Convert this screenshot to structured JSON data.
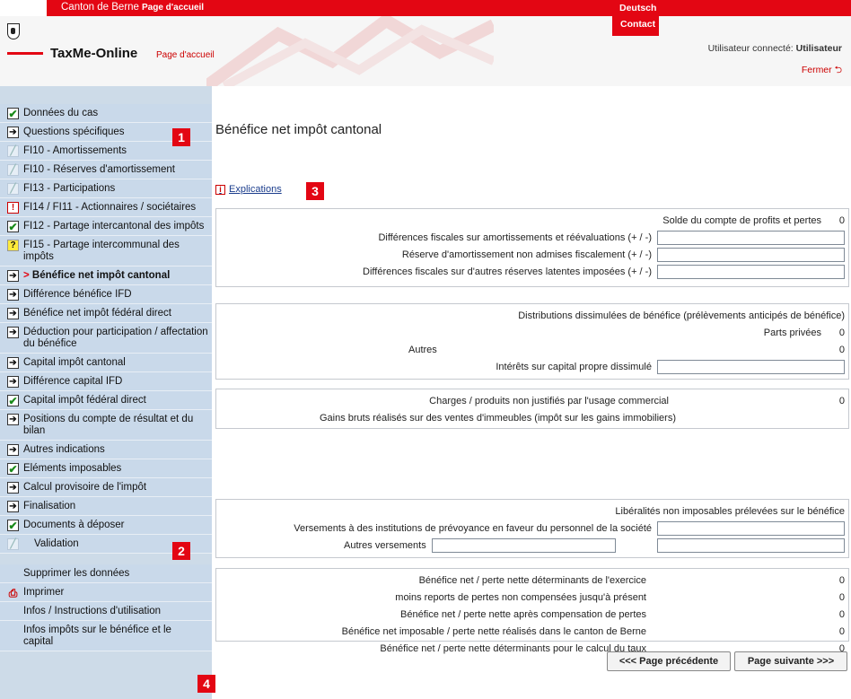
{
  "topbar": {
    "canton": "Canton de Berne",
    "home": "Page d'accueil",
    "language": "Deutsch"
  },
  "header": {
    "contact": "Contact",
    "app_title": "TaxMe-Online",
    "home": "Page d'accueil",
    "user_prefix": "Utilisateur connecté: ",
    "user_name": "Utilisateur",
    "logout": "Fermer"
  },
  "sidebar": {
    "items": [
      {
        "status": "ok",
        "label": "Données du cas"
      },
      {
        "status": "arrow",
        "label": "Questions spécifiques"
      },
      {
        "status": "pencil",
        "label": "FI10 - Amortissements"
      },
      {
        "status": "pencil",
        "label": "FI10 - Réserves d'amortissement"
      },
      {
        "status": "pencil",
        "label": "FI13 - Participations"
      },
      {
        "status": "warn",
        "label": "FI14 / FI11 - Actionnaires / sociétaires"
      },
      {
        "status": "ok",
        "label": "FI12 - Partage intercantonal des impôts"
      },
      {
        "status": "q",
        "label": "FI15 - Partage intercommunal des impôts"
      },
      {
        "status": "arrow",
        "label": "Bénéfice net impôt cantonal",
        "active_marker": ">"
      },
      {
        "status": "arrow",
        "label": "Différence bénéfice IFD"
      },
      {
        "status": "arrow",
        "label": "Bénéfice net impôt fédéral direct"
      },
      {
        "status": "arrow",
        "label": "Déduction pour participation / affectation du bénéfice"
      },
      {
        "status": "arrow",
        "label": "Capital impôt cantonal"
      },
      {
        "status": "arrow",
        "label": "Différence capital IFD"
      },
      {
        "status": "ok",
        "label": "Capital impôt fédéral direct"
      },
      {
        "status": "arrow",
        "label": "Positions du compte de résultat et du bilan"
      },
      {
        "status": "arrow",
        "label": "Autres indications"
      },
      {
        "status": "ok",
        "label": "Eléments imposables"
      },
      {
        "status": "arrow",
        "label": "Calcul provisoire de l'impôt"
      },
      {
        "status": "arrow",
        "label": "Finalisation"
      },
      {
        "status": "ok",
        "label": "Documents à déposer"
      },
      {
        "status": "pencil",
        "label": "Validation"
      }
    ],
    "tools": [
      {
        "label": "Supprimer les données"
      },
      {
        "label": "Imprimer"
      },
      {
        "label": "Infos / Instructions d'utilisation"
      },
      {
        "label": "Infos impôts sur le bénéfice et le capital"
      }
    ]
  },
  "badges": [
    "1",
    "2",
    "3",
    "4"
  ],
  "main": {
    "title": "Bénéfice net impôt cantonal",
    "explanations_link": "Explications",
    "section1": {
      "solde_label": "Solde du compte de profits et pertes",
      "solde_value": "0",
      "diff_amort_label": "Différences fiscales sur amortissements et réévaluations (+ / -)",
      "reserve_label": "Réserve d'amortissement non admises fiscalement (+ / -)",
      "diff_autres_label": "Différences fiscales sur d'autres réserves latentes imposées (+ / -)"
    },
    "section2": {
      "distributions_label": "Distributions dissimulées de bénéfice (prélèvements anticipés de bénéfice)",
      "parts_label": "Parts privées",
      "parts_value": "0",
      "autres_label": "Autres",
      "autres_value": "0",
      "interets_label": "Intérêts sur capital propre dissimulé"
    },
    "section3": {
      "charges_label": "Charges / produits non justifiés par l'usage commercial",
      "charges_value": "0",
      "gains_label": "Gains bruts réalisés sur des ventes d'immeubles (impôt sur les gains immobiliers)"
    },
    "section4": {
      "liberalites_label": "Libéralités non imposables prélevées sur le bénéfice",
      "versements_label": "Versements à des institutions de prévoyance en faveur du personnel de la société",
      "autres_versements_label": "Autres versements"
    },
    "section5": {
      "rows": [
        {
          "label": "Bénéfice net / perte nette déterminants de l'exercice",
          "value": "0"
        },
        {
          "label": "moins reports de pertes non compensées jusqu'à présent",
          "value": "0"
        },
        {
          "label": "Bénéfice net / perte nette après compensation de pertes",
          "value": "0"
        },
        {
          "label": "Bénéfice net imposable / perte nette réalisés dans le canton de Berne",
          "value": "0"
        },
        {
          "label": "Bénéfice net / perte nette déterminants pour le calcul du taux",
          "value": "0"
        }
      ]
    },
    "prev_button": "<<< Page précédente",
    "next_button": "Page suivante >>>"
  }
}
